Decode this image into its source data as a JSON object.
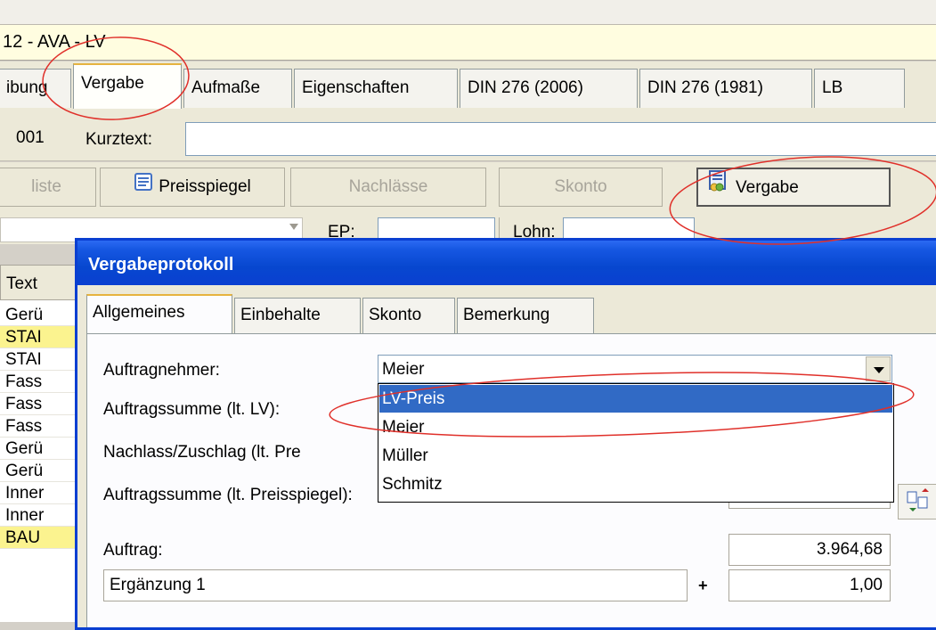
{
  "window": {
    "title": "12 - AVA - LV"
  },
  "main_tabs": [
    "ibung",
    "Vergabe",
    "Aufmaße",
    "Eigenschaften",
    "DIN 276 (2006)",
    "DIN 276 (1981)",
    "LB"
  ],
  "row3": {
    "number": "001",
    "kurztext_label": "Kurztext:"
  },
  "toolbar": {
    "liste": "liste",
    "preisspiegel": "Preisspiegel",
    "nachlaesse": "Nachlässe",
    "skonto": "Skonto",
    "vergabe": "Vergabe"
  },
  "fields": {
    "ep_label": "EP:",
    "lohn_label": "Lohn:"
  },
  "left_list": {
    "header": "Text",
    "rows": [
      "Gerü",
      "STAI",
      "STAI",
      "Fass",
      "Fass",
      "Fass",
      "Gerü",
      "Gerü",
      "Inner",
      "Inner",
      "BAU"
    ]
  },
  "dialog": {
    "title": "Vergabeprotokoll",
    "tabs": [
      "Allgemeines",
      "Einbehalte",
      "Skonto",
      "Bemerkung"
    ],
    "labels": {
      "auftragnehmer": "Auftragnehmer:",
      "auftragssumme_lv": "Auftragssumme (lt. LV):",
      "nachlass": "Nachlass/Zuschlag (lt. Pre",
      "auftragssumme_ps": "Auftragssumme (lt. Preisspiegel):",
      "auftrag": "Auftrag:"
    },
    "auftragnehmer_value": "Meier",
    "dropdown_options": [
      "LV-Preis",
      "Meier",
      "Müller",
      "Schmitz"
    ],
    "selected_option": "LV-Preis",
    "auftrag_value": "3.964,68",
    "ergaenzung_label": "Ergänzung 1",
    "ergaenzung_value": "1,00",
    "plus": "+"
  },
  "colors": {
    "annotation": "#e0302a",
    "selection": "#316ac5",
    "titlebar": "#0a3fd1"
  }
}
